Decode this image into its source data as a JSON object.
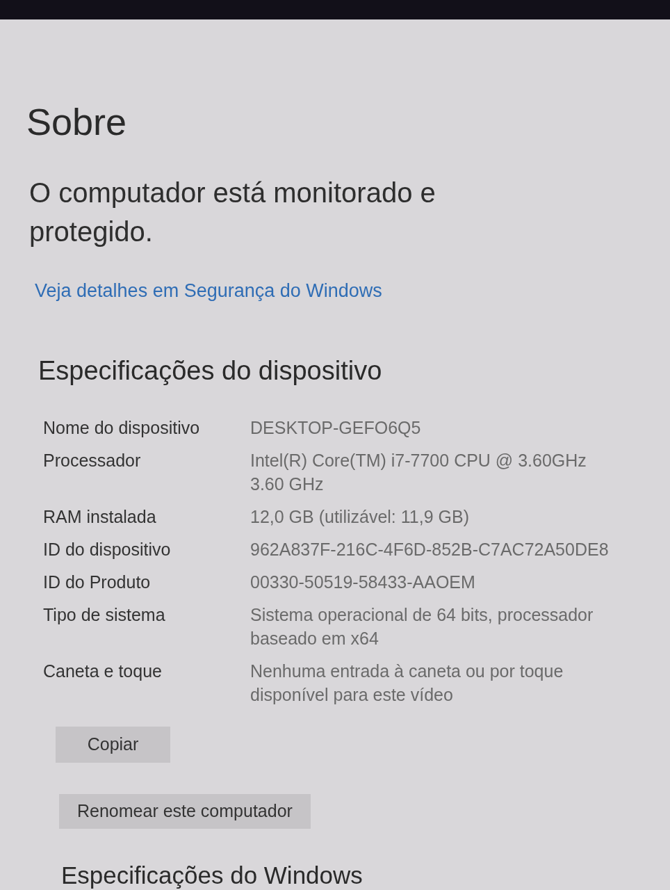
{
  "page": {
    "title": "Sobre"
  },
  "protection": {
    "status": "O computador está monitorado e protegido.",
    "link": "Veja detalhes em Segurança do Windows"
  },
  "device_specs": {
    "heading": "Especificações do dispositivo",
    "rows": [
      {
        "label": "Nome do dispositivo",
        "value": "DESKTOP-GEFO6Q5"
      },
      {
        "label": "Processador",
        "value": "Intel(R) Core(TM) i7-7700 CPU @ 3.60GHz 3.60 GHz"
      },
      {
        "label": "RAM instalada",
        "value": "12,0 GB (utilizável: 11,9 GB)"
      },
      {
        "label": "ID do dispositivo",
        "value": "962A837F-216C-4F6D-852B-C7AC72A50DE8"
      },
      {
        "label": "ID do Produto",
        "value": "00330-50519-58433-AAOEM"
      },
      {
        "label": "Tipo de sistema",
        "value": "Sistema operacional de 64 bits, processador baseado em x64"
      },
      {
        "label": "Caneta e toque",
        "value": "Nenhuma entrada à caneta ou por toque disponível para este vídeo"
      }
    ]
  },
  "buttons": [
    "Copiar",
    "Renomear este computador"
  ],
  "windows_specs": {
    "heading": "Especificações do Windows"
  }
}
